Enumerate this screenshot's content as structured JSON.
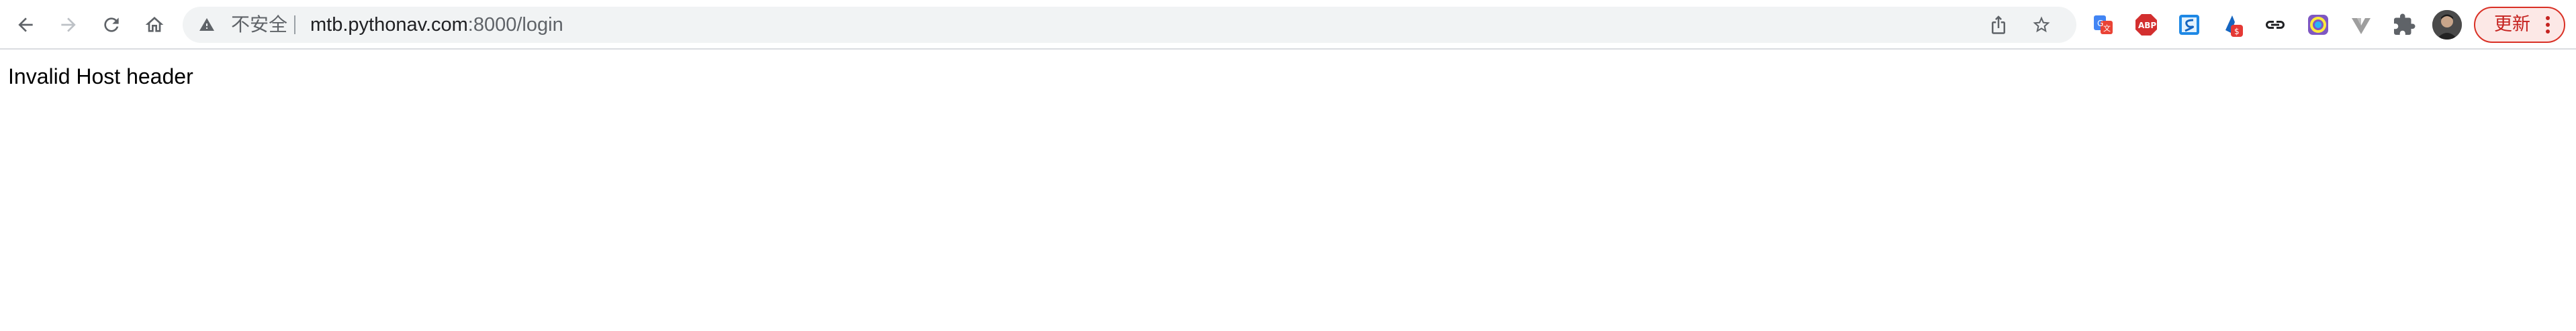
{
  "browser": {
    "security_label": "不安全",
    "url_host": "mtb.pythonav.com",
    "url_rest": ":8000/login",
    "update_label": "更新",
    "extensions": [
      {
        "name": "google-translate-icon"
      },
      {
        "name": "adblock-plus-icon"
      },
      {
        "name": "s-extension-icon"
      },
      {
        "name": "ext-badge-icon"
      },
      {
        "name": "link-icon"
      },
      {
        "name": "color-picker-icon"
      },
      {
        "name": "vue-devtools-icon"
      },
      {
        "name": "puzzle-icon"
      }
    ],
    "colors": {
      "toolbar_bg": "#ffffff",
      "omnibox_bg": "#f1f3f4",
      "update_accent": "#d93025"
    }
  },
  "page": {
    "message": "Invalid Host header"
  }
}
